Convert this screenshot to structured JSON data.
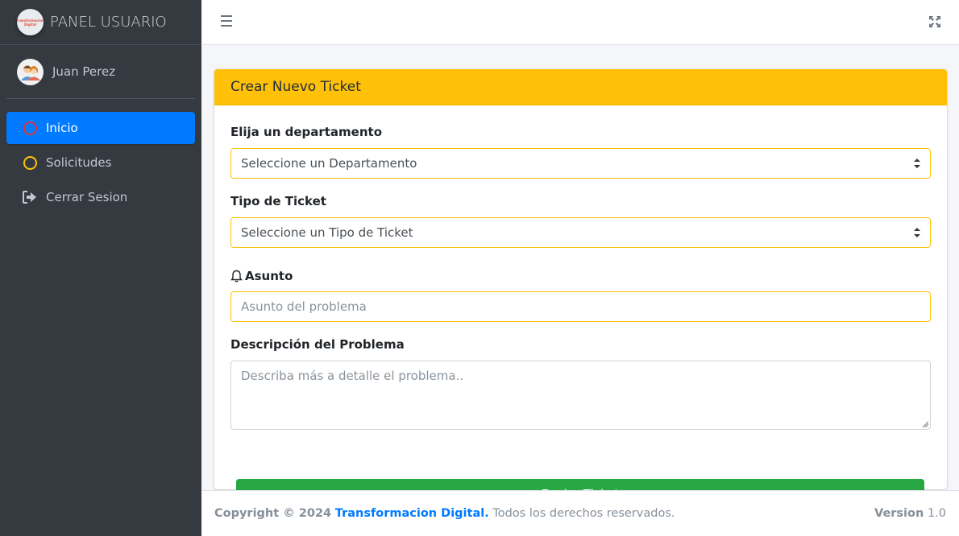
{
  "brand": {
    "title": "PANEL USUARIO",
    "logo_text": "Transformacion Digital"
  },
  "user": {
    "name": "Juan Perez"
  },
  "sidebar": {
    "items": [
      {
        "label": "Inicio",
        "icon": "circle-outline-icon",
        "color": "#dc3545",
        "active": true
      },
      {
        "label": "Solicitudes",
        "icon": "circle-outline-icon",
        "color": "#ffc107",
        "active": false
      },
      {
        "label": "Cerrar Sesion",
        "icon": "sign-out-icon",
        "color": "#c2c7d0",
        "active": false
      }
    ]
  },
  "card": {
    "title": "Crear Nuevo Ticket",
    "department_label": "Elija un departamento",
    "department_value": "Seleccione un Departamento",
    "ticket_type_label": "Tipo de Ticket",
    "ticket_type_value": "Seleccione un Tipo de Ticket",
    "subject_label": "Asunto",
    "subject_placeholder": "Asunto del problema",
    "description_label": "Descripción del Problema",
    "description_placeholder": "Describa más a detalle el problema..",
    "submit_label": "Enviar Ticket"
  },
  "footer": {
    "copyright": "Copyright © 2024",
    "company": "Transformacion Digital.",
    "rights": "Todos los derechos reservados.",
    "version_label": "Version",
    "version_value": "1.0"
  },
  "colors": {
    "accent": "#ffc107",
    "primary": "#007bff",
    "success": "#28a745",
    "sidebar": "#343a40"
  }
}
